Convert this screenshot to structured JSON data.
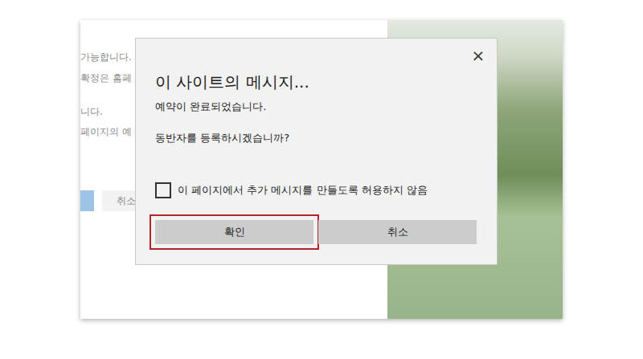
{
  "page": {
    "lines": [
      "가능합니다.",
      "확정은 홈페",
      "니다.",
      "페이지의 예"
    ],
    "buttons": [
      {
        "label": "",
        "kind": "primary"
      },
      {
        "label": "취소",
        "kind": "secondary"
      }
    ]
  },
  "dialog": {
    "title": "이 사이트의 메시지...",
    "close": "×",
    "messages": [
      "예약이 완료되었습니다.",
      "동반자를 등록하시겠습니까?"
    ],
    "checkbox": {
      "label": "이 페이지에서 추가 메시지를 만들도록 허용하지 않음",
      "checked": false
    },
    "buttons": [
      {
        "label": "확인",
        "highlighted": true
      },
      {
        "label": "취소",
        "highlighted": false
      }
    ]
  }
}
